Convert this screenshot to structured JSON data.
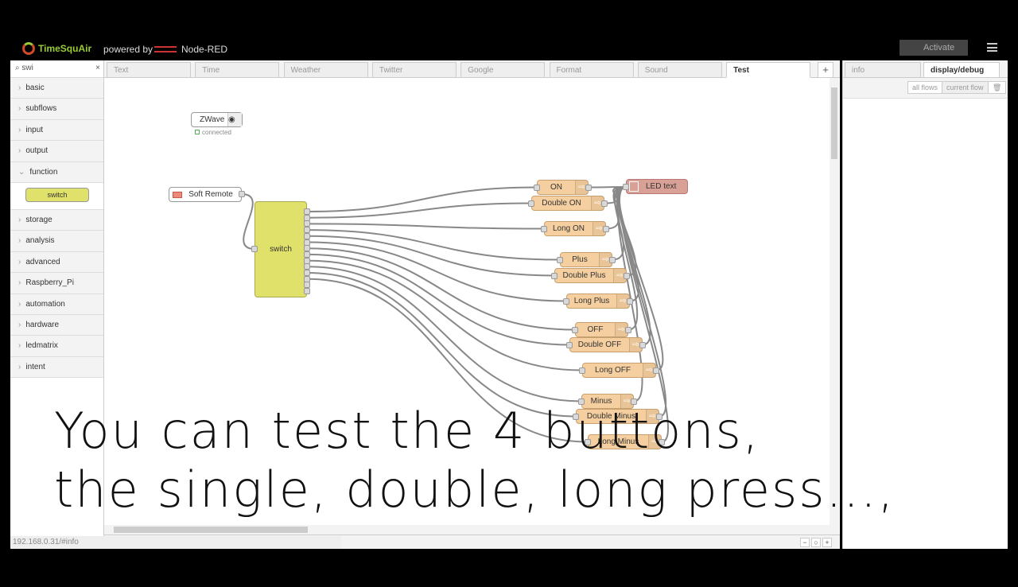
{
  "header": {
    "brand": "TimeSquAir",
    "powered_by": "powered by",
    "node_red": "Node-RED",
    "activate": "Activate"
  },
  "palette": {
    "search": "swi",
    "categories": [
      "basic",
      "subflows",
      "input",
      "output",
      "function",
      "storage",
      "analysis",
      "advanced",
      "Raspberry_Pi",
      "automation",
      "hardware",
      "ledmatrix",
      "intent"
    ],
    "function_node": "switch"
  },
  "tabs": [
    "Text",
    "Time",
    "Weather",
    "Twitter",
    "Google",
    "Format",
    "Sound",
    "Test"
  ],
  "active_tab": "Test",
  "sidebar": {
    "tabs": [
      "info",
      "display/debug"
    ],
    "filter_all": "all flows",
    "filter_current": "current flow"
  },
  "flow": {
    "zwave": {
      "label": "ZWave",
      "status": "connected"
    },
    "soft_remote": "Soft Remote",
    "switch": "switch",
    "led_text": "LED text",
    "format_nodes": [
      "ON",
      "Double ON",
      "Long ON",
      "Plus",
      "Double Plus",
      "Long Plus",
      "OFF",
      "Double OFF",
      "Long OFF",
      "Minus",
      "Double Minus",
      "Long Minus"
    ]
  },
  "status_url": "192.168.0.31/#info",
  "caption": [
    "You can test the 4 buttons,",
    "the single, double, long press...,"
  ],
  "colors": {
    "switch": "#dfe16a",
    "format": "#f5cf9f",
    "led": "#d9a096",
    "accent": "#999999"
  }
}
